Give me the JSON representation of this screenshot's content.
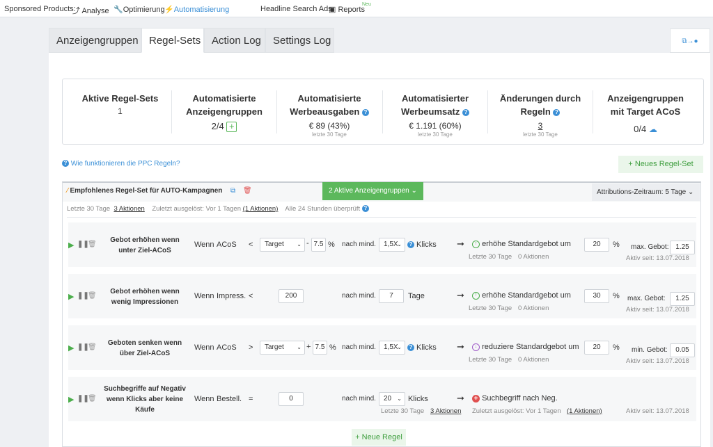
{
  "topnav": {
    "sponsored": "Sponsored Products:",
    "analyse": "Analyse",
    "optimierung": "Optimierung",
    "automatisierung": "Automatisierung",
    "headline": "Headline Search Ads:",
    "reports": "Reports",
    "neu": "Neu"
  },
  "tabs": [
    "Anzeigengruppen",
    "Regel-Sets",
    "Action Log",
    "Settings Log"
  ],
  "stats": [
    {
      "title1": "Aktive Regel-Sets",
      "title2": "",
      "value": "1",
      "sub": ""
    },
    {
      "title1": "Automatisierte",
      "title2": "Anzeigengruppen",
      "value": "2/4",
      "sub": ""
    },
    {
      "title1": "Automatisierte",
      "title2": "Werbeausgaben",
      "value": "€ 89 (43%)",
      "sub": "letzte 30 Tage"
    },
    {
      "title1": "Automatisierter",
      "title2": "Werbeumsatz",
      "value": "€ 1.191 (60%)",
      "sub": "letzte 30 Tage"
    },
    {
      "title1": "Änderungen durch",
      "title2": "Regeln",
      "value": "3",
      "sub": "letzte 30 Tage"
    },
    {
      "title1": "Anzeigengruppen",
      "title2": "mit Target ACoS",
      "value": "0/4",
      "sub": ""
    }
  ],
  "help_link": "Wie funktionieren die PPC Regeln?",
  "new_ruleset": "+ Neues Regel-Set",
  "ruleset": {
    "name": "Empfohlenes Regel-Set für AUTO-Kampagnen",
    "active_groups": "2 Aktive Anzeigengruppen",
    "attribution": "Attributions-Zeitraum: 5 Tage",
    "last30": "Letzte 30 Tage",
    "actions": "3 Aktionen",
    "last_run": "Zuletzt ausgelöst: Vor 1 Tagen",
    "last_run_actions": "(1 Aktionen)",
    "checked": "Alle 24 Stunden überprüft"
  },
  "rules": [
    {
      "name": "Gebot erhöhen wenn unter Ziel-ACoS",
      "wenn": "Wenn",
      "metric": "ACoS",
      "op": "<",
      "sel": "Target",
      "sign": "-",
      "factor": "7.5",
      "pct": "%",
      "nach": "nach mind.",
      "min": "1,5X",
      "unit": "Klicks",
      "action": "erhöhe Standardgebot um",
      "amount": "20",
      "pct2": "%",
      "limit_label": "max. Gebot:",
      "limit": "1.25",
      "stat1": "Letzte 30 Tage",
      "stat2": "0 Aktionen",
      "active": "Aktiv seit: 13.07.2018"
    },
    {
      "name": "Gebot erhöhen wenn wenig Impressionen",
      "wenn": "Wenn",
      "metric": "Impress.",
      "op": "<",
      "value": "200",
      "nach": "nach mind.",
      "min": "7",
      "unit": "Tage",
      "action": "erhöhe Standardgebot um",
      "amount": "30",
      "pct2": "%",
      "limit_label": "max. Gebot:",
      "limit": "1.25",
      "stat1": "Letzte 30 Tage",
      "stat2": "0 Aktionen",
      "active": "Aktiv seit: 13.07.2018"
    },
    {
      "name": "Geboten senken wenn über Ziel-ACoS",
      "wenn": "Wenn",
      "metric": "ACoS",
      "op": ">",
      "sel": "Target",
      "sign": "+",
      "factor": "7.5",
      "pct": "%",
      "nach": "nach mind.",
      "min": "1,5X",
      "unit": "Klicks",
      "action": "reduziere Standardgebot um",
      "amount": "20",
      "pct2": "%",
      "limit_label": "min. Gebot:",
      "limit": "0.05",
      "stat1": "Letzte 30 Tage",
      "stat2": "0 Aktionen",
      "active": "Aktiv seit: 13.07.2018"
    },
    {
      "name": "Suchbegriffe auf Negativ wenn Klicks aber keine Käufe",
      "wenn": "Wenn",
      "metric": "Bestell.",
      "op": "=",
      "value": "0",
      "nach": "nach mind.",
      "min": "20",
      "unit": "Klicks",
      "action": "Suchbegriff nach Neg.",
      "stat1": "Letzte 30 Tage",
      "stat2": "3 Aktionen",
      "stat3": "Zuletzt ausgelöst: Vor 1 Tagen",
      "stat4": "(1 Aktionen)",
      "active": "Aktiv seit: 13.07.2018"
    }
  ],
  "new_rule": "+ Neue Regel"
}
